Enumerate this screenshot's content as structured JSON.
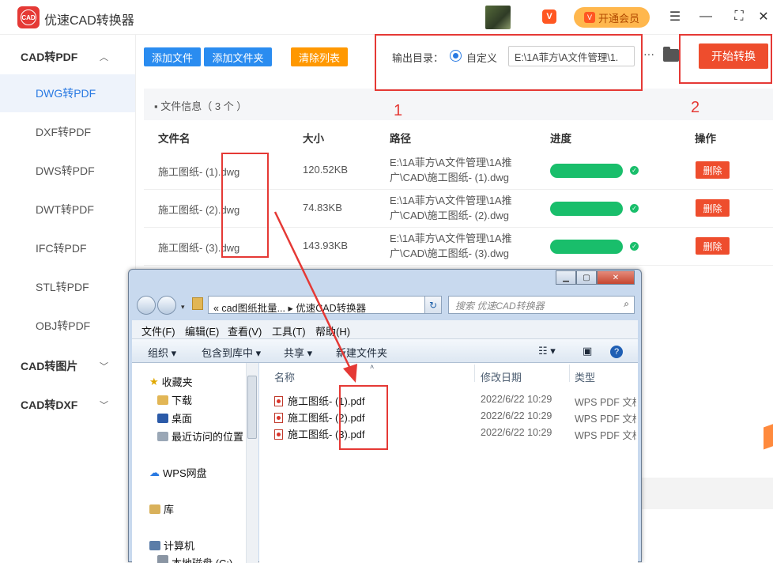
{
  "app": {
    "title": "优速CAD转换器",
    "logo_text": "CAD",
    "vip_button": "开通会员",
    "vip_badge": "VIP"
  },
  "sidebar": {
    "groups": [
      {
        "label": "CAD转PDF",
        "expanded": true
      },
      {
        "label": "CAD转图片",
        "expanded": false
      },
      {
        "label": "CAD转DXF",
        "expanded": false
      }
    ],
    "items": [
      {
        "label": "DWG转PDF",
        "active": true
      },
      {
        "label": "DXF转PDF"
      },
      {
        "label": "DWS转PDF"
      },
      {
        "label": "DWT转PDF"
      },
      {
        "label": "IFC转PDF"
      },
      {
        "label": "STL转PDF"
      },
      {
        "label": "OBJ转PDF"
      }
    ]
  },
  "toolbar": {
    "add_file": "添加文件",
    "add_folder": "添加文件夹",
    "clear_list": "清除列表",
    "output_label": "输出目录：",
    "custom_label": "自定义",
    "output_path": "E:\\1A菲方\\A文件管理\\1.",
    "more": "···",
    "start": "开始转换"
  },
  "annotations": {
    "one": "1",
    "two": "2"
  },
  "file_info": {
    "title": "文件信息（ 3 个 ）"
  },
  "table": {
    "headers": [
      "文件名",
      "大小",
      "路径",
      "进度",
      "操作"
    ],
    "rows": [
      {
        "name": "施工图纸- (1).dwg",
        "size": "120.52KB",
        "path1": "E:\\1A菲方\\A文件管理\\1A推",
        "path2": "广\\CAD\\施工图纸- (1).dwg",
        "progress": 1.0,
        "action": "删除"
      },
      {
        "name": "施工图纸- (2).dwg",
        "size": "74.83KB",
        "path1": "E:\\1A菲方\\A文件管理\\1A推",
        "path2": "广\\CAD\\施工图纸- (2).dwg",
        "progress": 1.0,
        "action": "删除"
      },
      {
        "name": "施工图纸- (3).dwg",
        "size": "143.93KB",
        "path1": "E:\\1A菲方\\A文件管理\\1A推",
        "path2": "广\\CAD\\施工图纸- (3).dwg",
        "progress": 1.0,
        "action": "删除"
      }
    ]
  },
  "explorer": {
    "address": "« cad图纸批量... ▸ 优速CAD转换器",
    "search_placeholder": "搜索 优速CAD转换器",
    "menus": [
      "文件(F)",
      "编辑(E)",
      "查看(V)",
      "工具(T)",
      "帮助(H)"
    ],
    "commands": [
      "组织 ▾",
      "包含到库中 ▾",
      "共享 ▾",
      "新建文件夹"
    ],
    "nav": {
      "favorites": "收藏夹",
      "downloads": "下载",
      "desktop": "桌面",
      "recent": "最近访问的位置",
      "wps": "WPS网盘",
      "library": "库",
      "computer": "计算机",
      "local_disk": "本地磁盘 (C:)"
    },
    "columns": [
      "名称",
      "修改日期",
      "类型"
    ],
    "files": [
      {
        "name": "施工图纸- (1).pdf",
        "date": "2022/6/22 10:29",
        "type": "WPS PDF 文档"
      },
      {
        "name": "施工图纸- (2).pdf",
        "date": "2022/6/22 10:29",
        "type": "WPS PDF 文档"
      },
      {
        "name": "施工图纸- (3).pdf",
        "date": "2022/6/22 10:29",
        "type": "WPS PDF 文档"
      }
    ]
  },
  "colors": {
    "accent": "#2a7ae2",
    "danger": "#ee4d2d",
    "progress": "#19be6b",
    "annotation": "#e53935"
  }
}
